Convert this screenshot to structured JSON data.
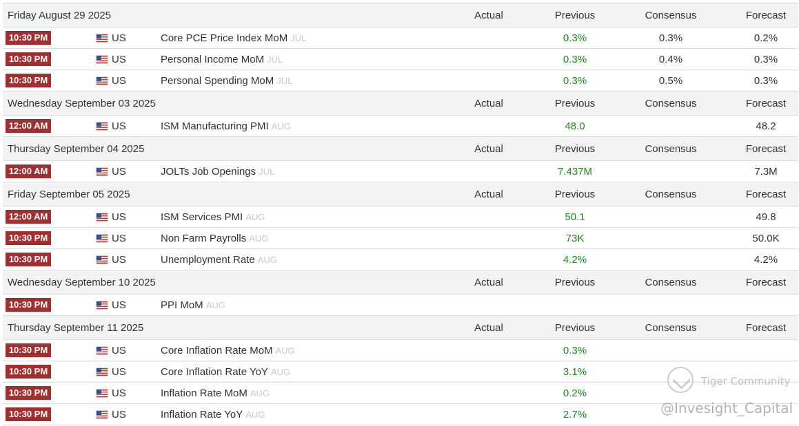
{
  "columns": {
    "actual": "Actual",
    "previous": "Previous",
    "consensus": "Consensus",
    "forecast": "Forecast"
  },
  "groups": [
    {
      "day": "Friday August 29 2025",
      "events": [
        {
          "time": "10:30 PM",
          "country": "US",
          "name": "Core PCE Price Index MoM",
          "ref": "JUL",
          "actual": "",
          "previous": "0.3%",
          "consensus": "0.3%",
          "forecast": "0.2%"
        },
        {
          "time": "10:30 PM",
          "country": "US",
          "name": "Personal Income MoM",
          "ref": "JUL",
          "actual": "",
          "previous": "0.3%",
          "consensus": "0.4%",
          "forecast": "0.3%"
        },
        {
          "time": "10:30 PM",
          "country": "US",
          "name": "Personal Spending MoM",
          "ref": "JUL",
          "actual": "",
          "previous": "0.3%",
          "consensus": "0.5%",
          "forecast": "0.3%"
        }
      ]
    },
    {
      "day": "Wednesday September 03 2025",
      "events": [
        {
          "time": "12:00 AM",
          "country": "US",
          "name": "ISM Manufacturing PMI",
          "ref": "AUG",
          "actual": "",
          "previous": "48.0",
          "consensus": "",
          "forecast": "48.2"
        }
      ]
    },
    {
      "day": "Thursday September 04 2025",
      "events": [
        {
          "time": "12:00 AM",
          "country": "US",
          "name": "JOLTs Job Openings",
          "ref": "JUL",
          "actual": "",
          "previous": "7.437M",
          "consensus": "",
          "forecast": "7.3M"
        }
      ]
    },
    {
      "day": "Friday September 05 2025",
      "events": [
        {
          "time": "12:00 AM",
          "country": "US",
          "name": "ISM Services PMI",
          "ref": "AUG",
          "actual": "",
          "previous": "50.1",
          "consensus": "",
          "forecast": "49.8"
        },
        {
          "time": "10:30 PM",
          "country": "US",
          "name": "Non Farm Payrolls",
          "ref": "AUG",
          "actual": "",
          "previous": "73K",
          "consensus": "",
          "forecast": "50.0K"
        },
        {
          "time": "10:30 PM",
          "country": "US",
          "name": "Unemployment Rate",
          "ref": "AUG",
          "actual": "",
          "previous": "4.2%",
          "consensus": "",
          "forecast": "4.2%"
        }
      ]
    },
    {
      "day": "Wednesday September 10 2025",
      "events": [
        {
          "time": "10:30 PM",
          "country": "US",
          "name": "PPI MoM",
          "ref": "AUG",
          "actual": "",
          "previous": "",
          "consensus": "",
          "forecast": ""
        }
      ]
    },
    {
      "day": "Thursday September 11 2025",
      "events": [
        {
          "time": "10:30 PM",
          "country": "US",
          "name": "Core Inflation Rate MoM",
          "ref": "AUG",
          "actual": "",
          "previous": "0.3%",
          "consensus": "",
          "forecast": ""
        },
        {
          "time": "10:30 PM",
          "country": "US",
          "name": "Core Inflation Rate YoY",
          "ref": "AUG",
          "actual": "",
          "previous": "3.1%",
          "consensus": "",
          "forecast": ""
        },
        {
          "time": "10:30 PM",
          "country": "US",
          "name": "Inflation Rate MoM",
          "ref": "AUG",
          "actual": "",
          "previous": "0.2%",
          "consensus": "",
          "forecast": ""
        },
        {
          "time": "10:30 PM",
          "country": "US",
          "name": "Inflation Rate YoY",
          "ref": "AUG",
          "actual": "",
          "previous": "2.7%",
          "consensus": "",
          "forecast": ""
        }
      ]
    }
  ],
  "watermark": {
    "brand": "Tiger Community",
    "handle": "@Invesight_Capital"
  },
  "colors": {
    "time_badge": "#a12f2f",
    "previous_value": "#1a8a1a",
    "header_bg": "#f3f3f3"
  }
}
